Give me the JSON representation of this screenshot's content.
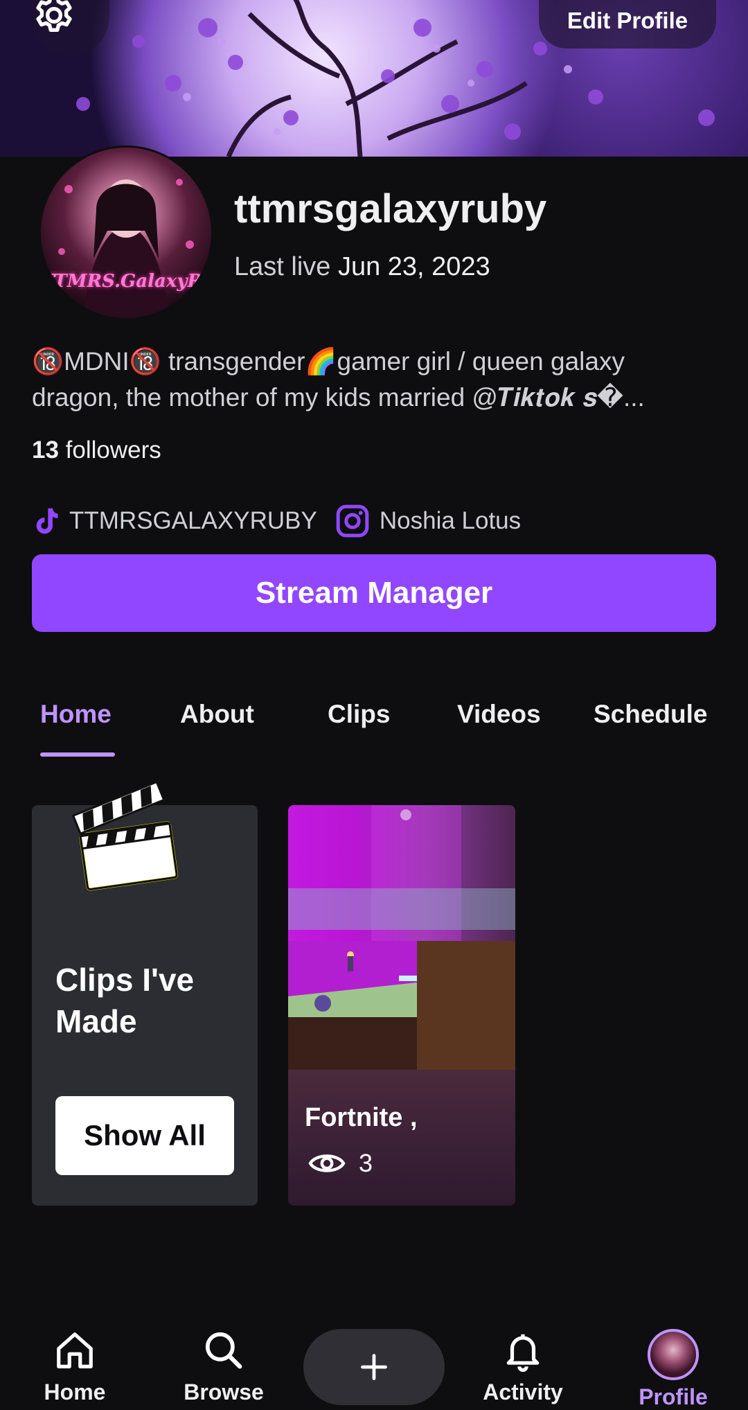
{
  "header": {
    "edit_profile_label": "Edit Profile"
  },
  "profile": {
    "username": "ttmrsgalaxyruby",
    "avatar_signature": "TTMRS.GalaxyRuby",
    "last_live_prefix": "Last live",
    "last_live_date": "Jun 23, 2023",
    "bio_line1": "🔞MDNI🔞 transgender🌈gamer girl / queen galaxy",
    "bio_line2": "dragon, the mother of my kids married @𝑻𝒊𝒌𝒕𝒐𝒌 𝒔�...",
    "followers_count": "13",
    "followers_label": "followers",
    "tiktok_handle": "TTMRSGALAXYRUBY",
    "instagram_handle": "Noshia Lotus"
  },
  "stream_manager_label": "Stream Manager",
  "tabs": [
    {
      "label": "Home",
      "active": true
    },
    {
      "label": "About"
    },
    {
      "label": "Clips"
    },
    {
      "label": "Videos"
    },
    {
      "label": "Schedule"
    }
  ],
  "clips_card": {
    "title": "Clips I've Made",
    "button_label": "Show All"
  },
  "clip": {
    "game": "Fortnite ,",
    "views": "3"
  },
  "bottom_nav": [
    {
      "label": "Home",
      "icon": "home-icon"
    },
    {
      "label": "Browse",
      "icon": "search-icon"
    },
    {
      "label": "Activity",
      "icon": "bell-icon"
    },
    {
      "label": "Profile",
      "icon": "avatar",
      "active": true
    }
  ],
  "colors": {
    "accent": "#9147ff",
    "accent_light": "#bf94ff",
    "background": "#0e0e10"
  }
}
